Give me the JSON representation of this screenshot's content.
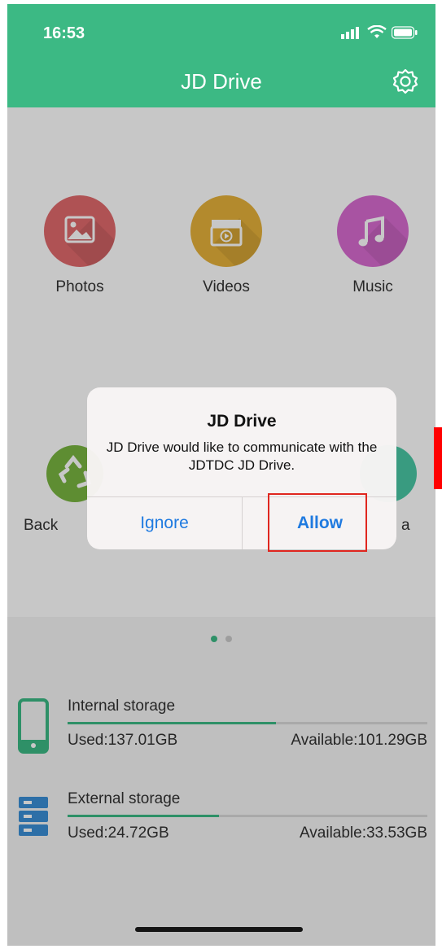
{
  "status_bar": {
    "time": "16:53"
  },
  "header": {
    "title": "JD Drive",
    "settings_icon": "gear-icon"
  },
  "tiles": [
    {
      "label": "Photos",
      "icon": "photo-icon",
      "color": "#e0696c"
    },
    {
      "label": "Videos",
      "icon": "clapperboard-icon",
      "color": "#e6b13a"
    },
    {
      "label": "Music",
      "icon": "music-note-icon",
      "color": "#d86bd0"
    },
    {
      "label": "Back",
      "icon": "recycle-icon",
      "color": "#79b540"
    },
    {
      "label": "a",
      "icon": "teal-circle-icon",
      "color": "#49c7a4"
    }
  ],
  "pager": {
    "pages": 2,
    "active": 1
  },
  "storage": [
    {
      "name": "Internal storage",
      "used": "Used:137.01GB",
      "available": "Available:101.29GB",
      "fill_fraction": 0.58,
      "icon": "phone-icon"
    },
    {
      "name": "External storage",
      "used": "Used:24.72GB",
      "available": "Available:33.53GB",
      "fill_fraction": 0.42,
      "icon": "server-icon"
    }
  ],
  "dialog": {
    "title": "JD Drive",
    "message": "JD Drive would like to communicate with the JDTDC JD Drive.",
    "ignore_label": "Ignore",
    "allow_label": "Allow"
  },
  "colors": {
    "accent": "#3cb984",
    "link": "#1f7ae0",
    "highlight": "#e0261f"
  }
}
